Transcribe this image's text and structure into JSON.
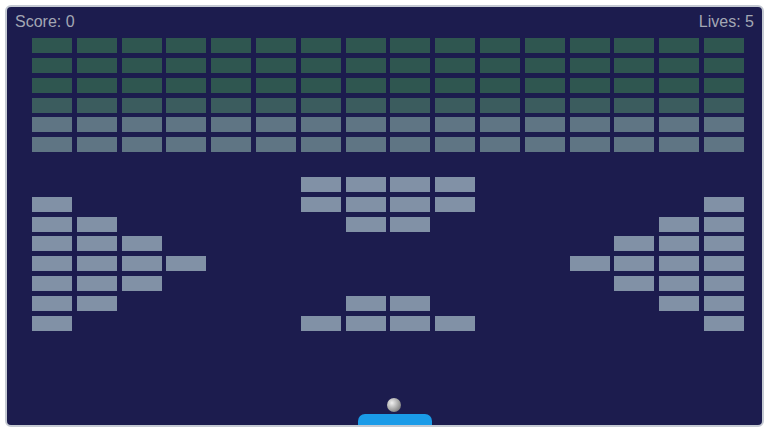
{
  "hud": {
    "score": "Score: 0",
    "lives": "Lives: 5"
  },
  "rows": [
    {
      "color": "#2f5650",
      "cells": [
        true,
        true,
        true,
        true,
        true,
        true,
        true,
        true,
        true,
        true,
        true,
        true,
        true,
        true,
        true,
        true
      ]
    },
    {
      "color": "#2f5650",
      "cells": [
        true,
        true,
        true,
        true,
        true,
        true,
        true,
        true,
        true,
        true,
        true,
        true,
        true,
        true,
        true,
        true
      ]
    },
    {
      "color": "#2f5650",
      "cells": [
        true,
        true,
        true,
        true,
        true,
        true,
        true,
        true,
        true,
        true,
        true,
        true,
        true,
        true,
        true,
        true
      ]
    },
    {
      "color": "#3b5c5e",
      "cells": [
        true,
        true,
        true,
        true,
        true,
        true,
        true,
        true,
        true,
        true,
        true,
        true,
        true,
        true,
        true,
        true
      ]
    },
    {
      "color": "#5f7584",
      "cells": [
        true,
        true,
        true,
        true,
        true,
        true,
        true,
        true,
        true,
        true,
        true,
        true,
        true,
        true,
        true,
        true
      ]
    },
    {
      "color": "#5f7584",
      "cells": [
        true,
        true,
        true,
        true,
        true,
        true,
        true,
        true,
        true,
        true,
        true,
        true,
        true,
        true,
        true,
        true
      ]
    },
    {
      "color": "#8191a6",
      "cells": [
        false,
        false,
        false,
        false,
        false,
        false,
        false,
        false,
        false,
        false,
        false,
        false,
        false,
        false,
        false,
        false
      ]
    },
    {
      "color": "#8191a6",
      "cells": [
        false,
        false,
        false,
        false,
        false,
        false,
        true,
        true,
        true,
        true,
        false,
        false,
        false,
        false,
        false,
        false
      ]
    },
    {
      "color": "#8191a6",
      "cells": [
        true,
        false,
        false,
        false,
        false,
        false,
        true,
        true,
        true,
        true,
        false,
        false,
        false,
        false,
        false,
        true
      ]
    },
    {
      "color": "#8191a6",
      "cells": [
        true,
        true,
        false,
        false,
        false,
        false,
        false,
        true,
        true,
        false,
        false,
        false,
        false,
        false,
        true,
        true
      ]
    },
    {
      "color": "#8191a6",
      "cells": [
        true,
        true,
        true,
        false,
        false,
        false,
        false,
        false,
        false,
        false,
        false,
        false,
        false,
        true,
        true,
        true
      ]
    },
    {
      "color": "#8191a6",
      "cells": [
        true,
        true,
        true,
        true,
        false,
        false,
        false,
        false,
        false,
        false,
        false,
        false,
        true,
        true,
        true,
        true
      ]
    },
    {
      "color": "#8191a6",
      "cells": [
        true,
        true,
        true,
        false,
        false,
        false,
        false,
        false,
        false,
        false,
        false,
        false,
        false,
        true,
        true,
        true
      ]
    },
    {
      "color": "#8191a6",
      "cells": [
        true,
        true,
        false,
        false,
        false,
        false,
        false,
        true,
        true,
        false,
        false,
        false,
        false,
        false,
        true,
        true
      ]
    },
    {
      "color": "#8191a6",
      "cells": [
        true,
        false,
        false,
        false,
        false,
        false,
        true,
        true,
        true,
        true,
        false,
        false,
        false,
        false,
        false,
        true
      ]
    }
  ]
}
